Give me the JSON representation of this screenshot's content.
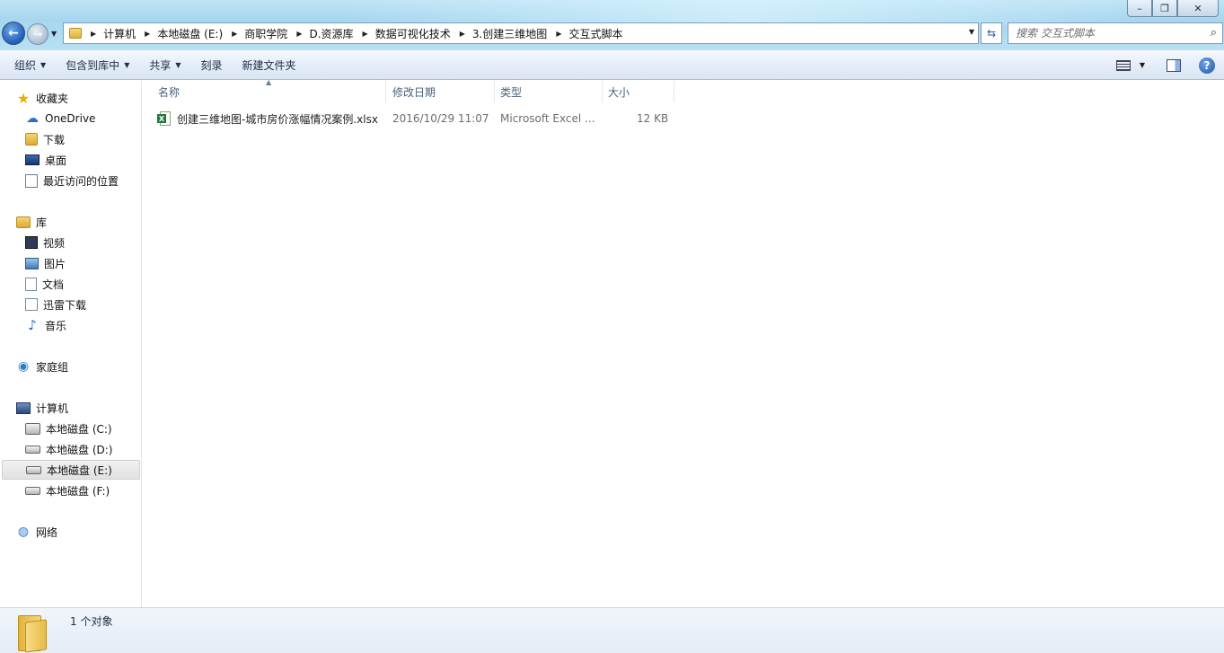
{
  "window": {
    "controls": {
      "minimize": "–",
      "restore": "❐",
      "close": "✕"
    }
  },
  "address": {
    "crumbs": [
      "计算机",
      "本地磁盘 (E:)",
      "商职学院",
      "D.资源库",
      "数据可视化技术",
      "3.创建三维地图",
      "交互式脚本"
    ]
  },
  "search": {
    "placeholder": "搜索 交互式脚本"
  },
  "toolbar": {
    "organize": "组织",
    "include_in_library": "包含到库中",
    "share": "共享",
    "burn": "刻录",
    "new_folder": "新建文件夹"
  },
  "nav": {
    "favorites": "收藏夹",
    "onedrive": "OneDrive",
    "downloads": "下载",
    "desktop": "桌面",
    "recent": "最近访问的位置",
    "libraries": "库",
    "videos": "视频",
    "pictures": "图片",
    "documents": "文档",
    "xunlei": "迅雷下载",
    "music": "音乐",
    "homegroup": "家庭组",
    "computer": "计算机",
    "drive_c": "本地磁盘 (C:)",
    "drive_d": "本地磁盘 (D:)",
    "drive_e": "本地磁盘 (E:)",
    "drive_f": "本地磁盘 (F:)",
    "network": "网络"
  },
  "columns": {
    "name": "名称",
    "modified": "修改日期",
    "type": "类型",
    "size": "大小"
  },
  "files": [
    {
      "name": "创建三维地图-城市房价涨幅情况案例.xlsx",
      "modified": "2016/10/29 11:07",
      "type": "Microsoft Excel ...",
      "size": "12 KB"
    }
  ],
  "status": {
    "count": "1 个对象"
  }
}
